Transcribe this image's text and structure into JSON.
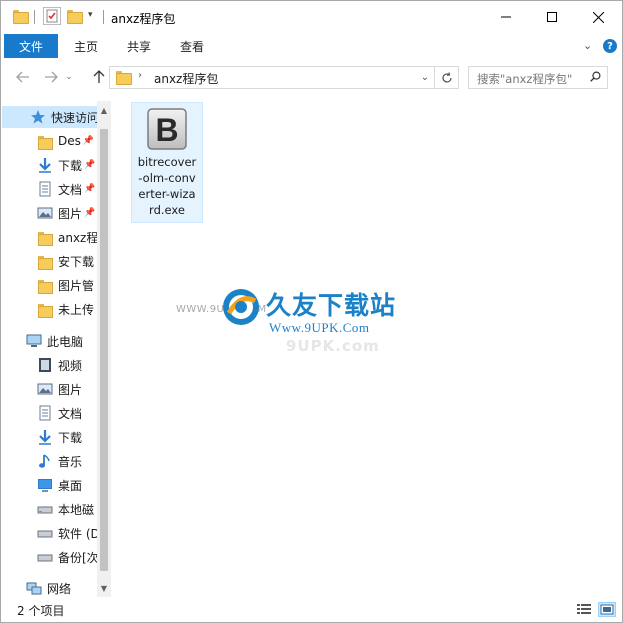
{
  "window": {
    "title": "anxz程序包"
  },
  "ribbon": {
    "tabs": [
      "文件",
      "主页",
      "共享",
      "查看"
    ],
    "help": "?"
  },
  "address": {
    "path_item": "anxz程序包",
    "search_placeholder": "搜索\"anxz程序包\""
  },
  "nav": {
    "quick_access": "快速访问",
    "pinned": [
      {
        "label": "Des",
        "icon": "folder-icon"
      },
      {
        "label": "下载",
        "icon": "download-icon"
      },
      {
        "label": "文档",
        "icon": "document-icon"
      },
      {
        "label": "图片",
        "icon": "picture-icon"
      }
    ],
    "recent": [
      {
        "label": "anxz程",
        "icon": "folder-icon"
      },
      {
        "label": "安下载",
        "icon": "folder-icon"
      },
      {
        "label": "图片管",
        "icon": "folder-icon"
      },
      {
        "label": "未上传",
        "icon": "folder-icon"
      }
    ],
    "this_pc": "此电脑",
    "pc_items": [
      {
        "label": "视频",
        "icon": "video-icon"
      },
      {
        "label": "图片",
        "icon": "picture-icon"
      },
      {
        "label": "文档",
        "icon": "document-icon"
      },
      {
        "label": "下载",
        "icon": "download-icon"
      },
      {
        "label": "音乐",
        "icon": "music-icon"
      },
      {
        "label": "桌面",
        "icon": "desktop-icon"
      },
      {
        "label": "本地磁",
        "icon": "drive-icon"
      },
      {
        "label": "软件 (D",
        "icon": "drive-icon"
      },
      {
        "label": "备份[次",
        "icon": "drive-icon"
      }
    ],
    "network": "网络"
  },
  "files": [
    {
      "name_lines": [
        "bitrecover",
        "-olm-conv",
        "erter-wiza",
        "rd.exe"
      ],
      "icon": "exe-b-icon",
      "icon_letter": "B"
    }
  ],
  "watermark": {
    "title": "久友下载站",
    "url": "Www.9UPK.Com",
    "left_text": "WWW.9UPK.COM",
    "ghost": "9UPK.com"
  },
  "status": {
    "count": "2 个项目"
  }
}
